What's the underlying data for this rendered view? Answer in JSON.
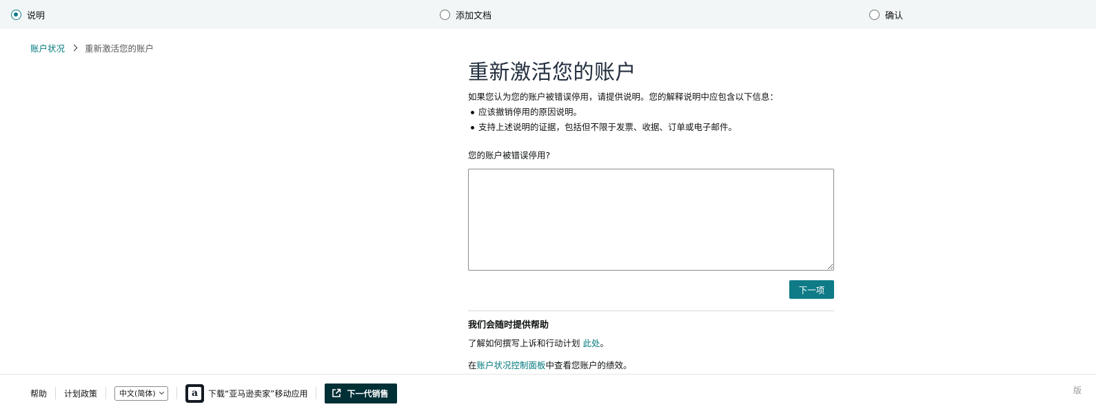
{
  "stepper": {
    "steps": [
      {
        "label": "说明",
        "state": "active"
      },
      {
        "label": "添加文档",
        "state": "inactive"
      },
      {
        "label": "确认",
        "state": "inactive"
      }
    ]
  },
  "breadcrumb": {
    "parent": "账户状况",
    "current": "重新激活您的账户"
  },
  "main": {
    "title": "重新激活您的账户",
    "description": "如果您认为您的账户被错误停用，请提供说明。您的解释说明中应包含以下信息：",
    "bullets": [
      "应该撤销停用的原因说明。",
      "支持上述说明的证据，包括但不限于发票、收据、订单或电子邮件。"
    ],
    "question": "您的账户被错误停用?",
    "explanation_value": "",
    "next_label": "下一项",
    "help": {
      "title": "我们会随时提供帮助",
      "line1_prefix": "了解如何撰写上诉和行动计划 ",
      "line1_link": "此处",
      "line1_suffix": "。",
      "line2_prefix": "在",
      "line2_link": "账户状况控制面板",
      "line2_suffix": "中查看您账户的绩效。"
    }
  },
  "footer": {
    "help": "帮助",
    "policy": "计划政策",
    "language": "中文(简体)",
    "app_download": "下载“亚马逊卖家”移动应用",
    "app_icon_letter": "a",
    "next_gen": "下一代销售",
    "right_text": "版"
  },
  "colors": {
    "accent": "#0e7b87",
    "link": "#00797d",
    "stepper_bg": "#f3f6f7",
    "next_gen_bg": "#002f36"
  }
}
